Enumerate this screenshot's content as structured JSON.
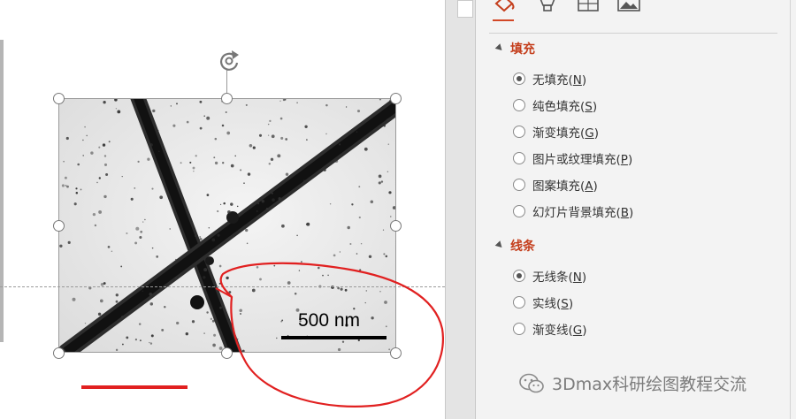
{
  "slide": {
    "image_scale_label": "500 nm"
  },
  "format_pane": {
    "tabs": [
      {
        "icon": "fill-line-icon",
        "active": true
      },
      {
        "icon": "effects-icon",
        "active": false
      },
      {
        "icon": "size-properties-icon",
        "active": false
      },
      {
        "icon": "picture-icon",
        "active": false
      }
    ],
    "fill_section": {
      "title": "填充",
      "options": [
        {
          "text": "无填充(",
          "key": "N",
          "tail": ")",
          "selected": true
        },
        {
          "text": "纯色填充(",
          "key": "S",
          "tail": ")",
          "selected": false
        },
        {
          "text": "渐变填充(",
          "key": "G",
          "tail": ")",
          "selected": false
        },
        {
          "text": "图片或纹理填充(",
          "key": "P",
          "tail": ")",
          "selected": false
        },
        {
          "text": "图案填充(",
          "key": "A",
          "tail": ")",
          "selected": false
        },
        {
          "text": "幻灯片背景填充(",
          "key": "B",
          "tail": ")",
          "selected": false
        }
      ]
    },
    "line_section": {
      "title": "线条",
      "options": [
        {
          "text": "无线条(",
          "key": "N",
          "tail": ")",
          "selected": true
        },
        {
          "text": "实线(",
          "key": "S",
          "tail": ")",
          "selected": false
        },
        {
          "text": "渐变线(",
          "key": "G",
          "tail": ")",
          "selected": false
        }
      ]
    }
  },
  "watermark": {
    "text": "3Dmax科研绘图教程交流",
    "icon": "wechat-icon"
  },
  "colors": {
    "accent": "#c43e1c",
    "annotation_red": "#e12020"
  }
}
